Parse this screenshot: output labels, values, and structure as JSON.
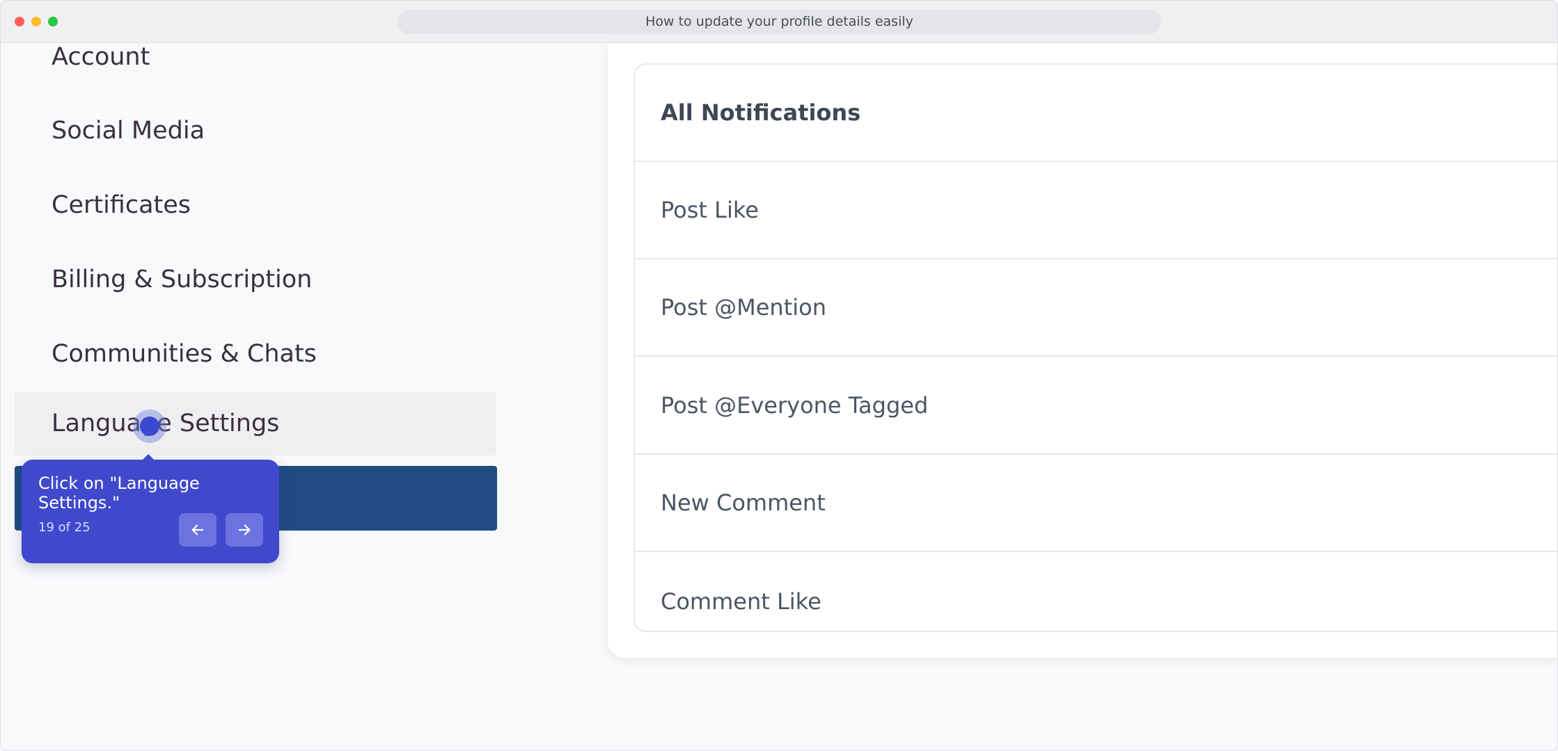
{
  "window": {
    "title": "How to update your profile details easily"
  },
  "sidebar": {
    "items": [
      {
        "label": "Account"
      },
      {
        "label": "Social Media"
      },
      {
        "label": "Certificates"
      },
      {
        "label": "Billing & Subscription"
      },
      {
        "label": "Communities & Chats"
      },
      {
        "label": "Language Settings",
        "active": true
      }
    ]
  },
  "tooltip": {
    "text": "Click on \"Language Settings.\"",
    "step": "19 of 25",
    "prev_icon": "arrow-left-icon",
    "next_icon": "arrow-right-icon",
    "color": "#4049cc"
  },
  "notifications": {
    "header": "All Notifications",
    "rows": [
      {
        "label": "Post Like"
      },
      {
        "label": "Post @Mention"
      },
      {
        "label": "Post @Everyone Tagged"
      },
      {
        "label": "New Comment"
      },
      {
        "label": "Comment Like"
      }
    ]
  },
  "colors": {
    "accent": "#4049cc",
    "highlight_bar": "#1f4b80"
  }
}
